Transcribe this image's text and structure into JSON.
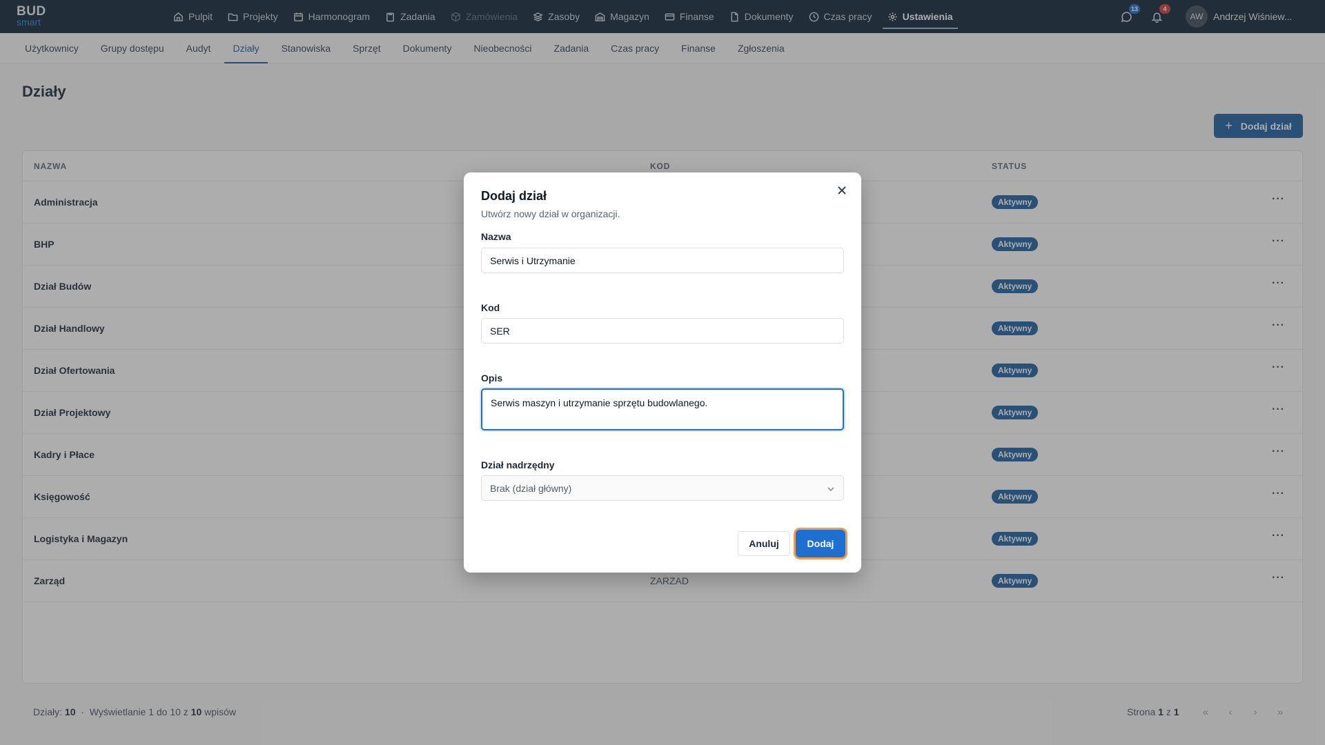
{
  "app": {
    "logo_top": "BUD",
    "logo_bottom": "smart"
  },
  "topnav": [
    {
      "label": "Pulpit",
      "icon": "home-icon"
    },
    {
      "label": "Projekty",
      "icon": "folder-icon"
    },
    {
      "label": "Harmonogram",
      "icon": "calendar-icon"
    },
    {
      "label": "Zadania",
      "icon": "clipboard-icon"
    },
    {
      "label": "Zamówienia",
      "icon": "box-icon"
    },
    {
      "label": "Zasoby",
      "icon": "layers-icon"
    },
    {
      "label": "Magazyn",
      "icon": "warehouse-icon"
    },
    {
      "label": "Finanse",
      "icon": "card-icon"
    },
    {
      "label": "Dokumenty",
      "icon": "document-icon"
    },
    {
      "label": "Czas pracy",
      "icon": "clock-icon"
    },
    {
      "label": "Ustawienia",
      "icon": "gear-icon"
    }
  ],
  "header_right": {
    "messages_count": "13",
    "notifications_count": "4",
    "avatar_initials": "AW",
    "user_name": "Andrzej Wiśniew..."
  },
  "subnav": [
    "Użytkownicy",
    "Grupy dostępu",
    "Audyt",
    "Działy",
    "Stanowiska",
    "Sprzęt",
    "Dokumenty",
    "Nieobecności",
    "Zadania",
    "Czas pracy",
    "Finanse",
    "Zgłoszenia"
  ],
  "page": {
    "title": "Działy",
    "add_button": "Dodaj dział",
    "add_button_plus": "+"
  },
  "table": {
    "headers": {
      "name": "NAZWA",
      "code": "KOD",
      "status": "STATUS"
    },
    "menu_glyph": "···",
    "rows": [
      {
        "name": "Administracja",
        "code": "",
        "status": "Aktywny"
      },
      {
        "name": "BHP",
        "code": "",
        "status": "Aktywny"
      },
      {
        "name": "Dział Budów",
        "code": "",
        "status": "Aktywny"
      },
      {
        "name": "Dział Handlowy",
        "code": "",
        "status": "Aktywny"
      },
      {
        "name": "Dział Ofertowania",
        "code": "",
        "status": "Aktywny"
      },
      {
        "name": "Dział Projektowy",
        "code": "",
        "status": "Aktywny"
      },
      {
        "name": "Kadry i Płace",
        "code": "",
        "status": "Aktywny"
      },
      {
        "name": "Księgowość",
        "code": "",
        "status": "Aktywny"
      },
      {
        "name": "Logistyka i Magazyn",
        "code": "",
        "status": "Aktywny"
      },
      {
        "name": "Zarząd",
        "code": "ZARZAD",
        "status": "Aktywny"
      }
    ]
  },
  "footer": {
    "count_label": "Działy:",
    "count": "10",
    "sep": "·",
    "showing_prefix": "Wyświetlanie 1 do 10 z",
    "showing_total": "10",
    "showing_suffix": "wpisów",
    "page_prefix": "Strona",
    "page_current": "1",
    "page_of": "z",
    "page_total": "1",
    "pager": [
      "«",
      "‹",
      "›",
      "»"
    ]
  },
  "modal": {
    "title": "Dodaj dział",
    "subtitle": "Utwórz nowy dział w organizacji.",
    "name_label": "Nazwa",
    "name_value": "Serwis i Utrzymanie",
    "code_label": "Kod",
    "code_value": "SER",
    "desc_label": "Opis",
    "desc_value": "Serwis maszyn i utrzymanie sprzętu budowlanego.",
    "parent_label": "Dział nadrzędny",
    "parent_value": "Brak (dział główny)",
    "cancel": "Anuluj",
    "submit": "Dodaj"
  }
}
